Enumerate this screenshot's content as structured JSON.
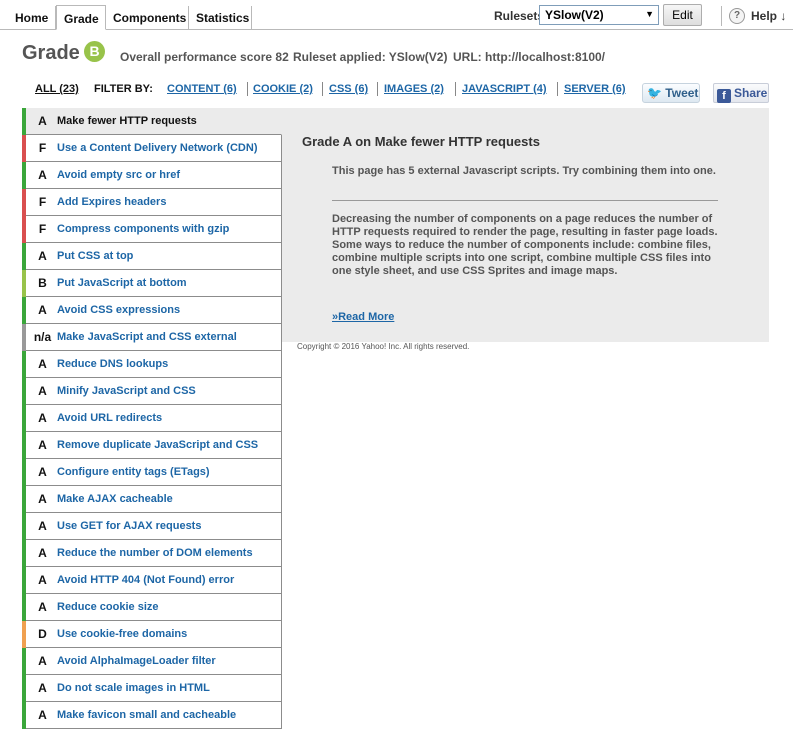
{
  "tabs": [
    {
      "label": "Home"
    },
    {
      "label": "Grade"
    },
    {
      "label": "Components"
    },
    {
      "label": "Statistics"
    }
  ],
  "toolbar": {
    "rulesets_label": "Rulesets",
    "ruleset_value": "YSlow(V2)",
    "edit_label": "Edit",
    "help_icon_glyph": "?",
    "help_label": "Help ↓"
  },
  "header": {
    "grade_label": "Grade",
    "grade_letter": "B",
    "grade_color": "#98c34a",
    "score_text": "Overall performance score 82",
    "ruleset_text": "Ruleset applied: YSlow(V2)",
    "url_text": "URL: http://localhost:8100/"
  },
  "filter": {
    "all_label": "ALL (23)",
    "by_label": "FILTER BY:",
    "links": [
      {
        "label": "CONTENT (6)"
      },
      {
        "label": "COOKIE (2)"
      },
      {
        "label": "CSS (6)"
      },
      {
        "label": "IMAGES (2)"
      },
      {
        "label": "JAVASCRIPT (4)"
      },
      {
        "label": "SERVER (6)"
      }
    ]
  },
  "social": {
    "tweet_label": "Tweet",
    "share_label": "Share",
    "fb_glyph": "f"
  },
  "grade_colors": {
    "A": "#3aa63a",
    "B": "#98c34a",
    "D": "#f0a050",
    "F": "#d94f4f",
    "n/a": "#999999"
  },
  "rules": [
    {
      "grade": "A",
      "name": "Make fewer HTTP requests",
      "selected": true
    },
    {
      "grade": "F",
      "name": "Use a Content Delivery Network (CDN)"
    },
    {
      "grade": "A",
      "name": "Avoid empty src or href"
    },
    {
      "grade": "F",
      "name": "Add Expires headers"
    },
    {
      "grade": "F",
      "name": "Compress components with gzip"
    },
    {
      "grade": "A",
      "name": "Put CSS at top"
    },
    {
      "grade": "B",
      "name": "Put JavaScript at bottom"
    },
    {
      "grade": "A",
      "name": "Avoid CSS expressions"
    },
    {
      "grade": "n/a",
      "name": "Make JavaScript and CSS external"
    },
    {
      "grade": "A",
      "name": "Reduce DNS lookups"
    },
    {
      "grade": "A",
      "name": "Minify JavaScript and CSS"
    },
    {
      "grade": "A",
      "name": "Avoid URL redirects"
    },
    {
      "grade": "A",
      "name": "Remove duplicate JavaScript and CSS"
    },
    {
      "grade": "A",
      "name": "Configure entity tags (ETags)"
    },
    {
      "grade": "A",
      "name": "Make AJAX cacheable"
    },
    {
      "grade": "A",
      "name": "Use GET for AJAX requests"
    },
    {
      "grade": "A",
      "name": "Reduce the number of DOM elements"
    },
    {
      "grade": "A",
      "name": "Avoid HTTP 404 (Not Found) error"
    },
    {
      "grade": "A",
      "name": "Reduce cookie size"
    },
    {
      "grade": "D",
      "name": "Use cookie-free domains"
    },
    {
      "grade": "A",
      "name": "Avoid AlphaImageLoader filter"
    },
    {
      "grade": "A",
      "name": "Do not scale images in HTML"
    },
    {
      "grade": "A",
      "name": "Make favicon small and cacheable"
    }
  ],
  "detail": {
    "title": "Grade A on Make fewer HTTP requests",
    "message": "This page has 5 external Javascript scripts. Try combining them into one.",
    "description": "Decreasing the number of components on a page reduces the number of HTTP requests required to render the page, resulting in faster page loads. Some ways to reduce the number of components include: combine files, combine multiple scripts into one script, combine multiple CSS files into one style sheet, and use CSS Sprites and image maps.",
    "read_more": "»Read More"
  },
  "footer": {
    "copyright": "Copyright © 2016 Yahoo! Inc. All rights reserved."
  }
}
